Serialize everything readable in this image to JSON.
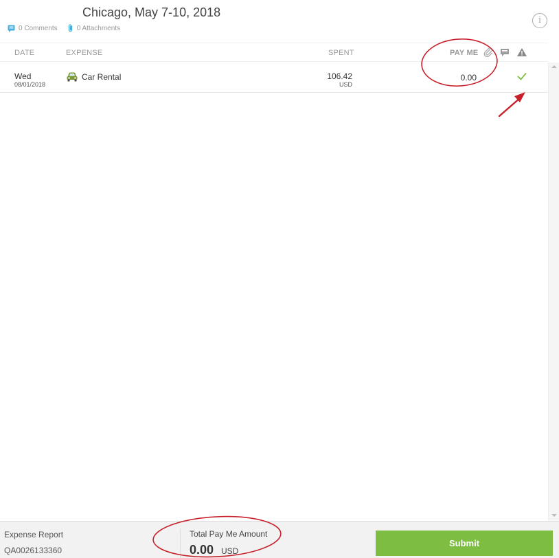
{
  "report": {
    "title": "Chicago, May 7-10, 2018",
    "comments_label": "0 Comments",
    "attachments_label": "0 Attachments"
  },
  "columns": {
    "date": "Date",
    "expense": "Expense",
    "spent": "Spent",
    "pay_me": "Pay Me",
    "icons": [
      "paperclip-icon",
      "comment-icon",
      "warning-icon"
    ]
  },
  "rows": [
    {
      "day": "Wed",
      "date": "08/01/2018",
      "expense": "Car Rental",
      "expense_icon": "car-icon",
      "spent": "106.42",
      "spent_currency": "USD",
      "pay_me": "0.00",
      "status_icon": "checkmark-icon"
    }
  ],
  "footer": {
    "report_label": "Expense Report",
    "report_id": "QA0026133360",
    "total_label": "Total Pay Me Amount",
    "total_amount": "0.00",
    "total_currency": "USD",
    "submit_label": "Submit"
  },
  "colors": {
    "accent_green": "#7dbd41",
    "icon_blue": "#4aaed9",
    "annotation_red": "#c8202a"
  }
}
